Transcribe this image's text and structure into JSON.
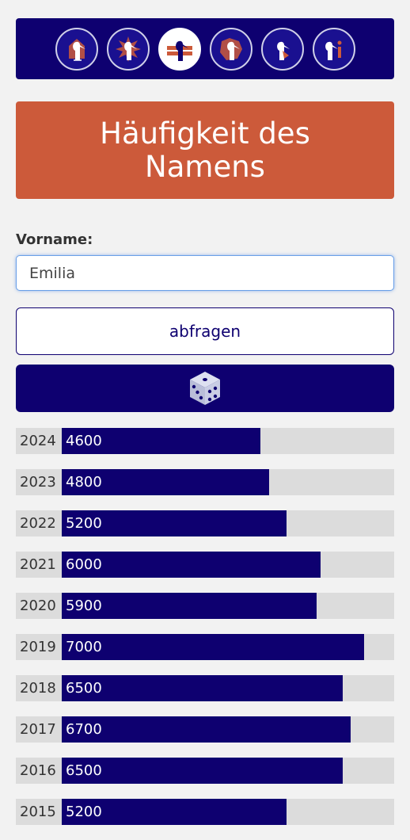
{
  "nav": {
    "icons": [
      {
        "name": "stork-home-icon",
        "active": false
      },
      {
        "name": "stork-burst-icon",
        "active": false
      },
      {
        "name": "stork-flag-icon",
        "active": true
      },
      {
        "name": "stork-map-icon",
        "active": false
      },
      {
        "name": "stork-baby-icon",
        "active": false
      },
      {
        "name": "stork-info-icon",
        "active": false
      }
    ]
  },
  "page": {
    "title": "Häufigkeit des Namens"
  },
  "form": {
    "label": "Vorname:",
    "input_value": "Emilia",
    "submit_label": "abfragen",
    "random_icon": "dice-icon"
  },
  "chart_data": {
    "type": "bar",
    "orientation": "horizontal",
    "categories": [
      "2024",
      "2023",
      "2022",
      "2021",
      "2020",
      "2019",
      "2018",
      "2017",
      "2016",
      "2015"
    ],
    "values": [
      4600,
      4800,
      5200,
      6000,
      5900,
      7000,
      6500,
      6700,
      6500,
      5200
    ],
    "xlim": [
      0,
      7700
    ],
    "colors": {
      "bar": "#0e0070",
      "track": "#dcdcdc",
      "label": "#ffffff"
    }
  }
}
